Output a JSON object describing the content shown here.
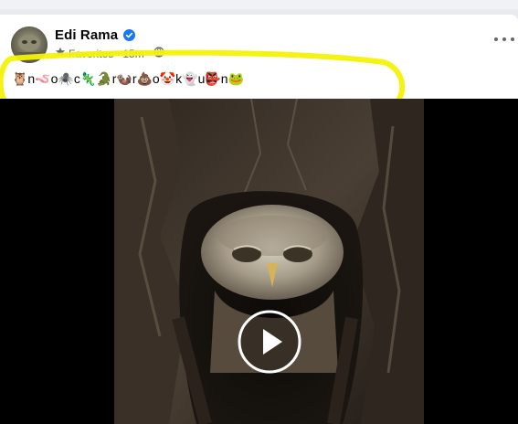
{
  "post": {
    "author_name": "Edi Rama",
    "author_verified": true,
    "audience": "Favorites",
    "separator": "·",
    "timestamp": "15m",
    "text": "🦉n🪱o🕷️c🦎🐊r🦦r💩o🤡k👻u👺n🐸"
  },
  "icons": {
    "verified": "verified-badge-icon",
    "audience_star": "star-icon",
    "privacy": "globe-icon",
    "more": "more-options-icon",
    "play": "play-icon"
  },
  "colors": {
    "verified": "#1877f2",
    "highlight": "#f4f20a",
    "secondary_text": "#65676b"
  },
  "video": {
    "subject": "owl in tree hollow"
  }
}
